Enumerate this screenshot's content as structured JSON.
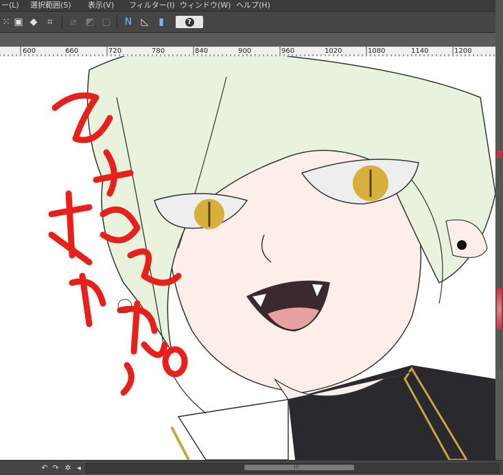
{
  "menu": {
    "layer": "ー(L)",
    "selection": "選択範囲(S)",
    "view": "表示(V)",
    "filter": "フィルター(I)",
    "window": "ウィンドウ(W)",
    "help": "ヘルプ(H)"
  },
  "toolbar": {
    "icons": [
      "transform-handles-icon",
      "layer-box-icon",
      "eraser-fill-icon",
      "crop-frame-icon",
      "pen-disabled-icon",
      "tone-disabled-icon",
      "square-disabled-icon",
      "vector-n-icon",
      "ruler-triangle-icon",
      "snap-ruler-icon"
    ],
    "help_glyph": "?"
  },
  "ruler": {
    "ticks": [
      "600",
      "660",
      "720",
      "780",
      "840",
      "900",
      "960",
      "1020",
      "1080",
      "1140",
      "1200"
    ]
  },
  "canvas": {
    "handwriting": "ひざまる来ませんNO",
    "colors": {
      "ink": "#e8201c",
      "hair": "#e8f2dc",
      "skin": "#fdeeea",
      "eye": "#d6b03a",
      "coat": "#2a2a2e",
      "trim": "#c9a640"
    }
  },
  "statusbar": {
    "icons": [
      "undo-icon",
      "redo-icon",
      "settings-icon",
      "scroll-left-icon"
    ],
    "scroll_grip": "|||"
  }
}
